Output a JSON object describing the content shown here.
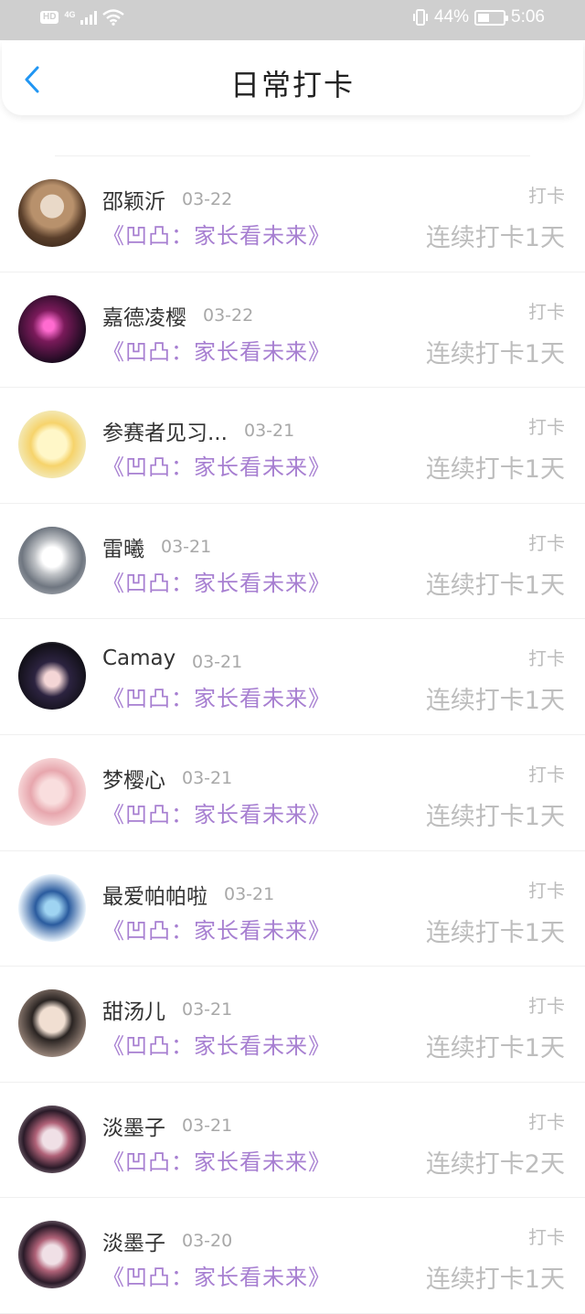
{
  "status_bar": {
    "hd": "HD",
    "network": "4G",
    "battery_percent": "44%",
    "time": "5:06",
    "battery_level": 0.44
  },
  "header": {
    "back_icon": "chevron-left-icon",
    "title": "日常打卡",
    "accent_color": "#2196f3"
  },
  "entries": [
    {
      "name": "邵颖沂",
      "date": "03-22",
      "course": "《凹凸：家长看未来》",
      "action": "打卡",
      "streak": "连续打卡1天"
    },
    {
      "name": "嘉德凌樱",
      "date": "03-22",
      "course": "《凹凸：家长看未来》",
      "action": "打卡",
      "streak": "连续打卡1天"
    },
    {
      "name": "参赛者见习...",
      "date": "03-21",
      "course": "《凹凸：家长看未来》",
      "action": "打卡",
      "streak": "连续打卡1天"
    },
    {
      "name": "雷曦",
      "date": "03-21",
      "course": "《凹凸：家长看未来》",
      "action": "打卡",
      "streak": "连续打卡1天"
    },
    {
      "name": "Camay",
      "date": "03-21",
      "course": "《凹凸：家长看未来》",
      "action": "打卡",
      "streak": "连续打卡1天"
    },
    {
      "name": "梦樱心",
      "date": "03-21",
      "course": "《凹凸：家长看未来》",
      "action": "打卡",
      "streak": "连续打卡1天"
    },
    {
      "name": "最爱帕帕啦",
      "date": "03-21",
      "course": "《凹凸：家长看未来》",
      "action": "打卡",
      "streak": "连续打卡1天"
    },
    {
      "name": "甜汤儿",
      "date": "03-21",
      "course": "《凹凸：家长看未来》",
      "action": "打卡",
      "streak": "连续打卡1天"
    },
    {
      "name": "淡墨子",
      "date": "03-21",
      "course": "《凹凸：家长看未来》",
      "action": "打卡",
      "streak": "连续打卡2天"
    },
    {
      "name": "淡墨子",
      "date": "03-20",
      "course": "《凹凸：家长看未来》",
      "action": "打卡",
      "streak": "连续打卡1天"
    }
  ],
  "colors": {
    "course_text": "#a77fd1",
    "muted_text": "#bdbdbd",
    "status_bar_bg": "#cfcfcf"
  }
}
